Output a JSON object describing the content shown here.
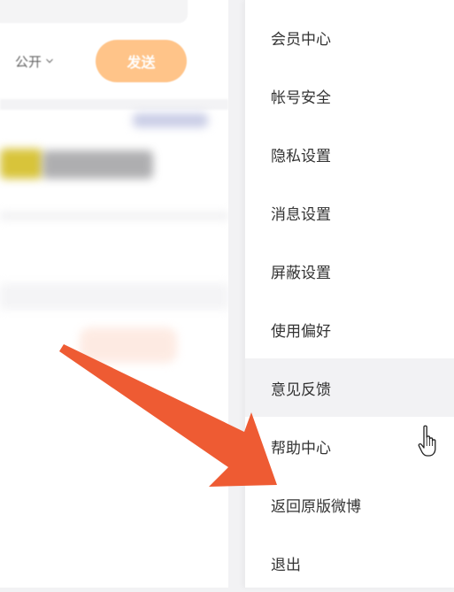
{
  "composer": {
    "visibility_label": "公开",
    "send_label": "发送"
  },
  "menu": {
    "items": [
      {
        "label": "会员中心"
      },
      {
        "label": "帐号安全"
      },
      {
        "label": "隐私设置"
      },
      {
        "label": "消息设置"
      },
      {
        "label": "屏蔽设置"
      },
      {
        "label": "使用偏好"
      },
      {
        "label": "意见反馈"
      },
      {
        "label": "帮助中心"
      },
      {
        "label": "返回原版微博"
      },
      {
        "label": "退出"
      }
    ],
    "hovered_index": 6
  },
  "colors": {
    "send_button": "#ffc489",
    "arrow": "#ee5b33",
    "menu_hover": "#f2f2f4",
    "menu_text": "#333333"
  },
  "icons": {
    "dropdown": "chevron-down-icon",
    "cursor": "hand-pointer-icon",
    "annotation": "arrow-icon"
  }
}
